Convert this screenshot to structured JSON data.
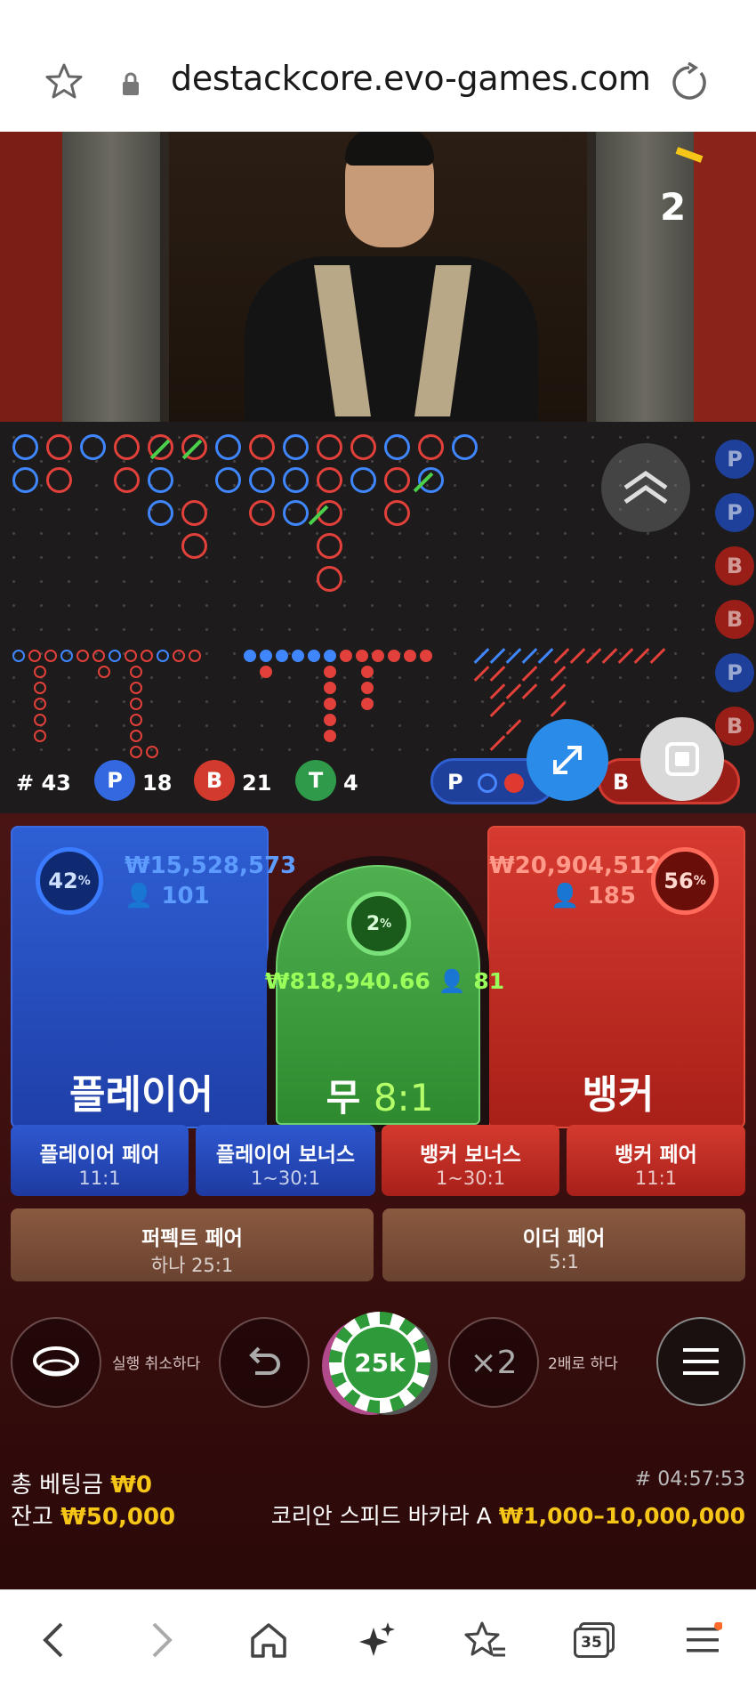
{
  "browser": {
    "url": "destackcore.evo-games.com",
    "tab_count": "35"
  },
  "video": {
    "round_marker": "2"
  },
  "stats": {
    "hash": "# 43",
    "player_label": "P",
    "player_count": "18",
    "banker_label": "B",
    "banker_count": "21",
    "tie_label": "T",
    "tie_count": "4",
    "predict_p": "P",
    "predict_b": "B"
  },
  "side_labels": [
    "P",
    "P",
    "B",
    "B",
    "P",
    "B"
  ],
  "player": {
    "pct": "42",
    "pct_unit": "%",
    "amount": "₩15,528,573",
    "users": "101",
    "label": "플레이어"
  },
  "tie": {
    "pct": "2",
    "pct_unit": "%",
    "amount": "₩818,940.66",
    "users": "81",
    "label": "무",
    "odds": "8:1"
  },
  "banker": {
    "pct": "56",
    "pct_unit": "%",
    "amount": "₩20,904,512",
    "users": "185",
    "label": "뱅커"
  },
  "side_bets": [
    {
      "title": "플레이어 페어",
      "odds": "11:1"
    },
    {
      "title": "플레이어 보너스",
      "odds": "1~30:1"
    },
    {
      "title": "뱅커 보너스",
      "odds": "1~30:1"
    },
    {
      "title": "뱅커 페어",
      "odds": "11:1"
    }
  ],
  "pair_bets": [
    {
      "title": "퍼펙트 페어",
      "odds": "하나 25:1"
    },
    {
      "title": "이더 페어",
      "odds": "5:1"
    }
  ],
  "controls": {
    "undo_label": "실행 취소하다",
    "chip_value": "25k",
    "double_symbol": "×2",
    "double_label": "2배로 하다"
  },
  "footer": {
    "total_bet_label": "총 베팅금",
    "total_bet_value": "₩0",
    "balance_label": "잔고",
    "balance_value": "₩50,000",
    "round_id": "# 04:57:53",
    "table_name": "코리안 스피드 바카라 A",
    "limits": "₩1,000–10,000,000"
  },
  "colors": {
    "player": "#2f5fd0",
    "banker": "#d13a30",
    "tie": "#3aa53a",
    "gold": "#f5c518"
  }
}
